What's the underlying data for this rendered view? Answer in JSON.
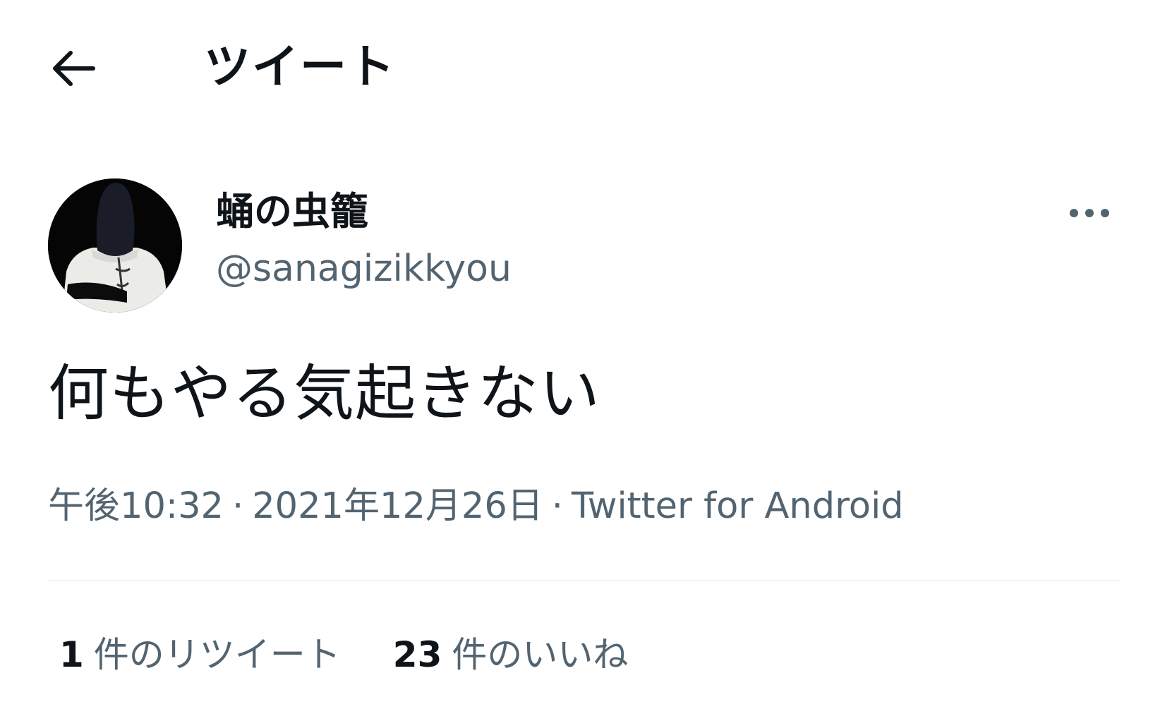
{
  "header": {
    "back_icon": "arrow-left-icon",
    "title": "ツイート"
  },
  "tweet": {
    "author": {
      "display_name": "蛹の虫籠",
      "handle": "@sanagizikkyou"
    },
    "more_icon": "more-horizontal-icon",
    "text": "何もやる気起きない",
    "time": "午後10:32",
    "separator": "·",
    "date": "2021年12月26日",
    "source": "Twitter for Android",
    "stats": {
      "retweets_count": "1",
      "retweets_label": "件のリツイート",
      "likes_count": "23",
      "likes_label": "件のいいね"
    }
  },
  "colors": {
    "text_primary": "#0f1419",
    "text_secondary": "#536471",
    "divider": "#eff3f4",
    "background": "#ffffff"
  }
}
